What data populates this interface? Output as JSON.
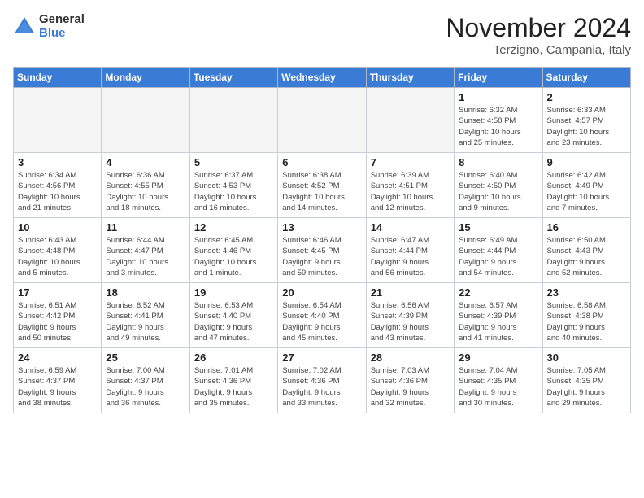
{
  "logo": {
    "general": "General",
    "blue": "Blue"
  },
  "title": "November 2024",
  "location": "Terzigno, Campania, Italy",
  "weekdays": [
    "Sunday",
    "Monday",
    "Tuesday",
    "Wednesday",
    "Thursday",
    "Friday",
    "Saturday"
  ],
  "weeks": [
    [
      {
        "day": "",
        "info": ""
      },
      {
        "day": "",
        "info": ""
      },
      {
        "day": "",
        "info": ""
      },
      {
        "day": "",
        "info": ""
      },
      {
        "day": "",
        "info": ""
      },
      {
        "day": "1",
        "info": "Sunrise: 6:32 AM\nSunset: 4:58 PM\nDaylight: 10 hours\nand 25 minutes."
      },
      {
        "day": "2",
        "info": "Sunrise: 6:33 AM\nSunset: 4:57 PM\nDaylight: 10 hours\nand 23 minutes."
      }
    ],
    [
      {
        "day": "3",
        "info": "Sunrise: 6:34 AM\nSunset: 4:56 PM\nDaylight: 10 hours\nand 21 minutes."
      },
      {
        "day": "4",
        "info": "Sunrise: 6:36 AM\nSunset: 4:55 PM\nDaylight: 10 hours\nand 18 minutes."
      },
      {
        "day": "5",
        "info": "Sunrise: 6:37 AM\nSunset: 4:53 PM\nDaylight: 10 hours\nand 16 minutes."
      },
      {
        "day": "6",
        "info": "Sunrise: 6:38 AM\nSunset: 4:52 PM\nDaylight: 10 hours\nand 14 minutes."
      },
      {
        "day": "7",
        "info": "Sunrise: 6:39 AM\nSunset: 4:51 PM\nDaylight: 10 hours\nand 12 minutes."
      },
      {
        "day": "8",
        "info": "Sunrise: 6:40 AM\nSunset: 4:50 PM\nDaylight: 10 hours\nand 9 minutes."
      },
      {
        "day": "9",
        "info": "Sunrise: 6:42 AM\nSunset: 4:49 PM\nDaylight: 10 hours\nand 7 minutes."
      }
    ],
    [
      {
        "day": "10",
        "info": "Sunrise: 6:43 AM\nSunset: 4:48 PM\nDaylight: 10 hours\nand 5 minutes."
      },
      {
        "day": "11",
        "info": "Sunrise: 6:44 AM\nSunset: 4:47 PM\nDaylight: 10 hours\nand 3 minutes."
      },
      {
        "day": "12",
        "info": "Sunrise: 6:45 AM\nSunset: 4:46 PM\nDaylight: 10 hours\nand 1 minute."
      },
      {
        "day": "13",
        "info": "Sunrise: 6:46 AM\nSunset: 4:45 PM\nDaylight: 9 hours\nand 59 minutes."
      },
      {
        "day": "14",
        "info": "Sunrise: 6:47 AM\nSunset: 4:44 PM\nDaylight: 9 hours\nand 56 minutes."
      },
      {
        "day": "15",
        "info": "Sunrise: 6:49 AM\nSunset: 4:44 PM\nDaylight: 9 hours\nand 54 minutes."
      },
      {
        "day": "16",
        "info": "Sunrise: 6:50 AM\nSunset: 4:43 PM\nDaylight: 9 hours\nand 52 minutes."
      }
    ],
    [
      {
        "day": "17",
        "info": "Sunrise: 6:51 AM\nSunset: 4:42 PM\nDaylight: 9 hours\nand 50 minutes."
      },
      {
        "day": "18",
        "info": "Sunrise: 6:52 AM\nSunset: 4:41 PM\nDaylight: 9 hours\nand 49 minutes."
      },
      {
        "day": "19",
        "info": "Sunrise: 6:53 AM\nSunset: 4:40 PM\nDaylight: 9 hours\nand 47 minutes."
      },
      {
        "day": "20",
        "info": "Sunrise: 6:54 AM\nSunset: 4:40 PM\nDaylight: 9 hours\nand 45 minutes."
      },
      {
        "day": "21",
        "info": "Sunrise: 6:56 AM\nSunset: 4:39 PM\nDaylight: 9 hours\nand 43 minutes."
      },
      {
        "day": "22",
        "info": "Sunrise: 6:57 AM\nSunset: 4:39 PM\nDaylight: 9 hours\nand 41 minutes."
      },
      {
        "day": "23",
        "info": "Sunrise: 6:58 AM\nSunset: 4:38 PM\nDaylight: 9 hours\nand 40 minutes."
      }
    ],
    [
      {
        "day": "24",
        "info": "Sunrise: 6:59 AM\nSunset: 4:37 PM\nDaylight: 9 hours\nand 38 minutes."
      },
      {
        "day": "25",
        "info": "Sunrise: 7:00 AM\nSunset: 4:37 PM\nDaylight: 9 hours\nand 36 minutes."
      },
      {
        "day": "26",
        "info": "Sunrise: 7:01 AM\nSunset: 4:36 PM\nDaylight: 9 hours\nand 35 minutes."
      },
      {
        "day": "27",
        "info": "Sunrise: 7:02 AM\nSunset: 4:36 PM\nDaylight: 9 hours\nand 33 minutes."
      },
      {
        "day": "28",
        "info": "Sunrise: 7:03 AM\nSunset: 4:36 PM\nDaylight: 9 hours\nand 32 minutes."
      },
      {
        "day": "29",
        "info": "Sunrise: 7:04 AM\nSunset: 4:35 PM\nDaylight: 9 hours\nand 30 minutes."
      },
      {
        "day": "30",
        "info": "Sunrise: 7:05 AM\nSunset: 4:35 PM\nDaylight: 9 hours\nand 29 minutes."
      }
    ]
  ]
}
